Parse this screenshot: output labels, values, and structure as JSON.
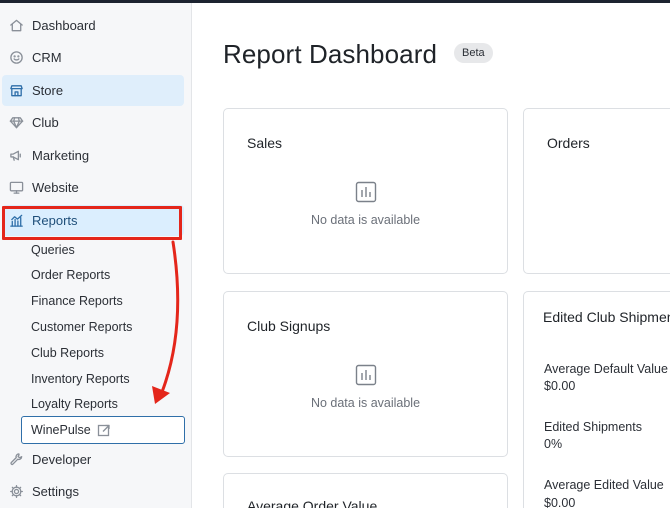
{
  "sidebar": {
    "items": [
      {
        "label": "Dashboard",
        "icon": "home-icon"
      },
      {
        "label": "CRM",
        "icon": "smiley-icon"
      },
      {
        "label": "Store",
        "icon": "store-icon"
      },
      {
        "label": "Club",
        "icon": "diamond-icon"
      },
      {
        "label": "Marketing",
        "icon": "megaphone-icon"
      },
      {
        "label": "Website",
        "icon": "monitor-icon"
      },
      {
        "label": "Reports",
        "icon": "chart-icon"
      },
      {
        "label": "Developer",
        "icon": "wrench-icon"
      },
      {
        "label": "Settings",
        "icon": "gear-icon"
      }
    ],
    "reports_submenu": [
      "Queries",
      "Order Reports",
      "Finance Reports",
      "Customer Reports",
      "Club Reports",
      "Inventory Reports",
      "Loyalty Reports"
    ],
    "winepulse_label": "WinePulse"
  },
  "main": {
    "title": "Report Dashboard",
    "badge": "Beta",
    "cards": {
      "sales": {
        "title": "Sales",
        "empty": "No data is available"
      },
      "orders": {
        "title": "Orders"
      },
      "club_signups": {
        "title": "Club Signups",
        "empty": "No data is available"
      },
      "edited_club": {
        "title": "Edited Club Shipments",
        "metrics": [
          {
            "label": "Average Default Value",
            "value": "$0.00"
          },
          {
            "label": "Edited Shipments",
            "value": "0%"
          },
          {
            "label": "Average Edited Value",
            "value": "$0.00"
          }
        ]
      },
      "avg_order": {
        "title": "Average Order Value"
      }
    }
  },
  "colors": {
    "highlight": "#e4261b",
    "accent": "#2f6fa9",
    "active_bg": "#dbeefe"
  }
}
